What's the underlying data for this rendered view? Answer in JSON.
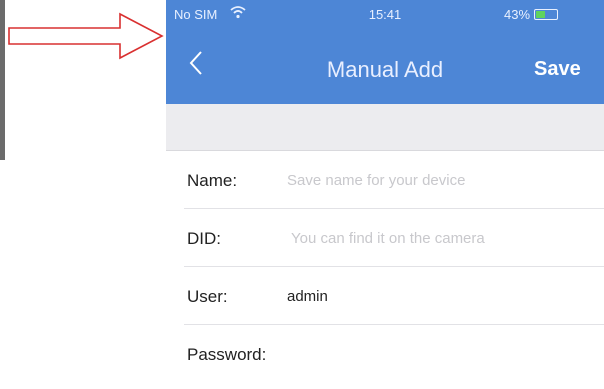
{
  "status_bar": {
    "carrier": "No SIM",
    "time": "15:41",
    "battery_percent": "43%",
    "battery_level": 0.43
  },
  "nav": {
    "title": "Manual Add",
    "save_label": "Save"
  },
  "form": {
    "name_label": "Name:",
    "name_placeholder": "Save name for your device",
    "name_value": "",
    "did_label": "DID:",
    "did_placeholder": "You can find it on the camera",
    "did_value": "",
    "user_label": "User:",
    "user_value": "admin",
    "password_label": "Password:",
    "password_value": ""
  },
  "colors": {
    "header_blue": "#4d86d6",
    "arrow_red": "#d93030"
  }
}
